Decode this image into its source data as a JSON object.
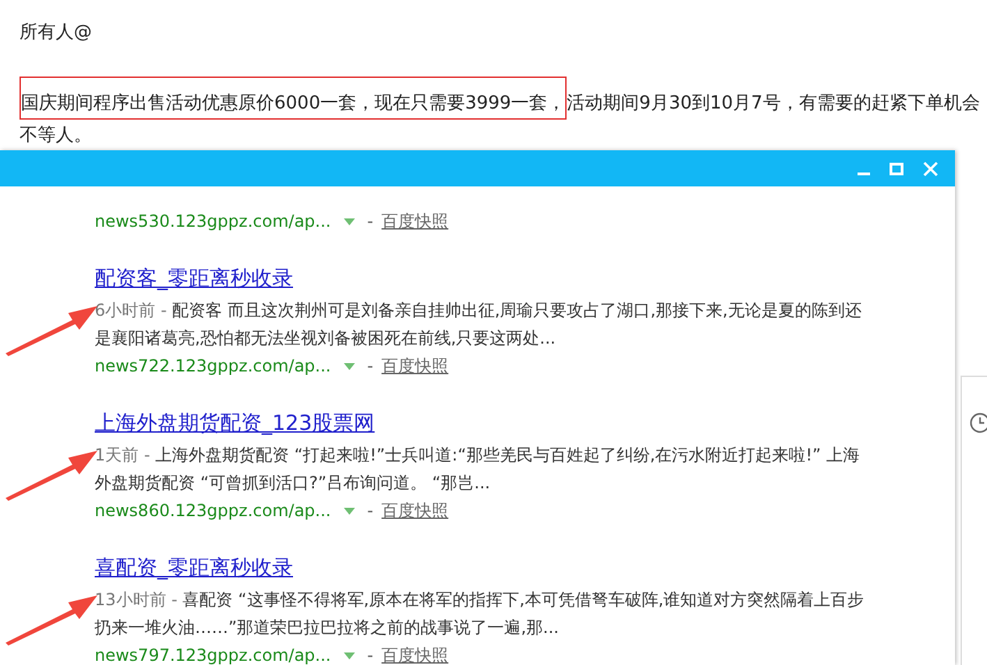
{
  "message": {
    "mention": "所有人@",
    "highlighted": "国庆期间程序出售活动优惠原价6000一套，现在只需要3999一套，",
    "rest": "活动期间9月30到10月7号，有需要的赶紧下单机会不等人。"
  },
  "window": {
    "controls": [
      {
        "kind": "minimize"
      },
      {
        "kind": "maximize"
      },
      {
        "kind": "close"
      }
    ]
  },
  "results": [
    {
      "marked": false,
      "url": "news530.123gppz.com/ap...",
      "separator": "-",
      "cache": "百度快照"
    },
    {
      "marked": true,
      "title": "配资客_零距离秒收录",
      "time": "6小时前 - ",
      "snippet": "配资客 而且这次荆州可是刘备亲自挂帅出征,周瑜只要攻占了湖口,那接下来,无论是夏的陈到还是襄阳诸葛亮,恐怕都无法坐视刘备被困死在前线,只要这两处...",
      "url": "news722.123gppz.com/ap...",
      "separator": "-",
      "cache": "百度快照"
    },
    {
      "marked": true,
      "title": "上海外盘期货配资_123股票网",
      "time": "1天前 - ",
      "snippet": "上海外盘期货配资 “打起来啦!”士兵叫道:“那些羌民与百姓起了纠纷,在污水附近打起来啦!” 上海外盘期货配资 “可曾抓到活口?”吕布询问道。 “那岂...",
      "url": "news860.123gppz.com/ap...",
      "separator": "-",
      "cache": "百度快照"
    },
    {
      "marked": true,
      "title": "喜配资_零距离秒收录",
      "time": "13小时前 - ",
      "snippet": "喜配资 “这事怪不得将军,原本在将军的指挥下,本可凭借弩车破阵,谁知道对方突然隔着上百步扔来一堆火油……”那道荣巴拉巴拉将之前的战事说了一遍,那...",
      "url": "news797.123gppz.com/ap...",
      "separator": "-",
      "cache": "百度快照"
    }
  ]
}
